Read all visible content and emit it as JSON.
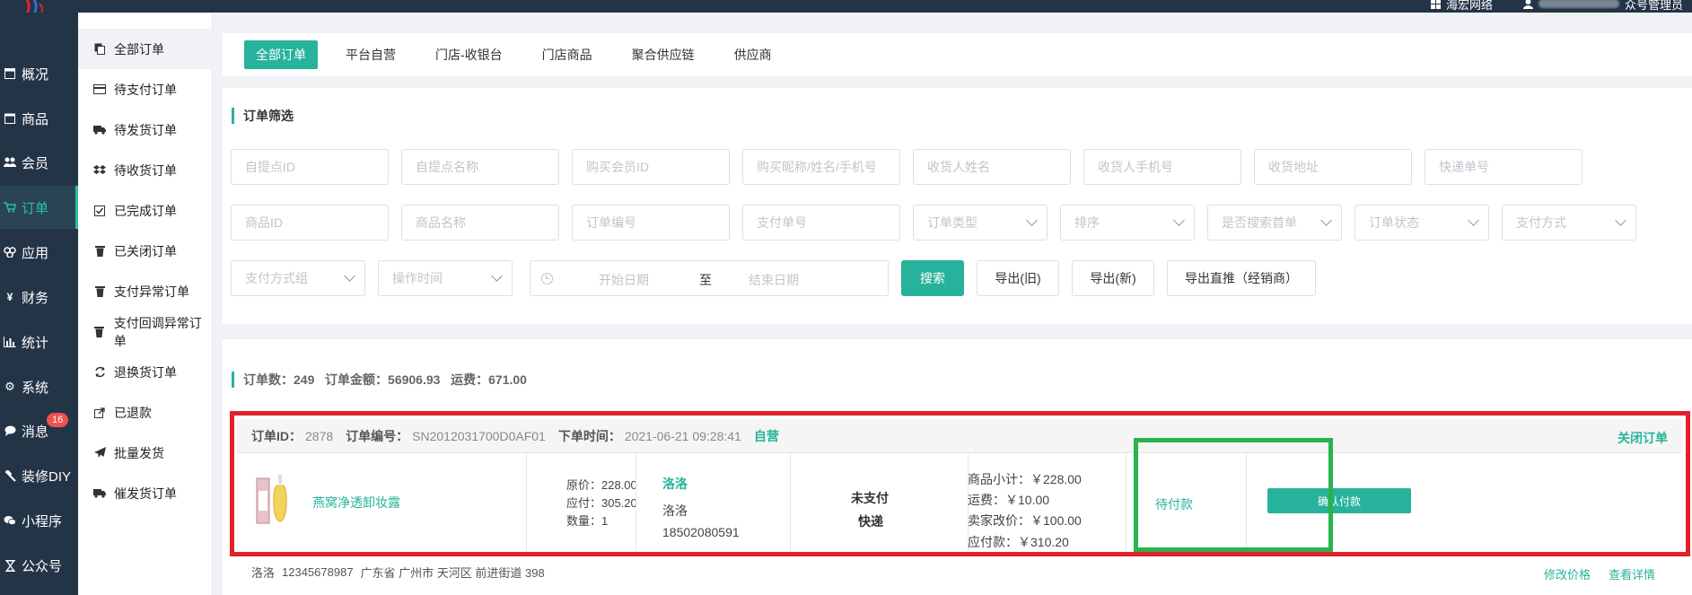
{
  "header": {
    "account_name": "海宏网络",
    "user_suffix": "众号管理员"
  },
  "nav": {
    "items": [
      {
        "label": "概况",
        "icon": "monitor-icon"
      },
      {
        "label": "商品",
        "icon": "box-icon"
      },
      {
        "label": "会员",
        "icon": "users-icon"
      },
      {
        "label": "订单",
        "icon": "cart-icon"
      },
      {
        "label": "应用",
        "icon": "apps-icon"
      },
      {
        "label": "财务",
        "icon": "yen-icon"
      },
      {
        "label": "统计",
        "icon": "bar-chart-icon"
      },
      {
        "label": "系统",
        "icon": "gears-icon"
      },
      {
        "label": "消息",
        "icon": "message-icon"
      },
      {
        "label": "装修DIY",
        "icon": "hammer-icon"
      },
      {
        "label": "小程序",
        "icon": "wechat-icon"
      },
      {
        "label": "公众号",
        "icon": "hourglass-icon"
      }
    ],
    "message_badge": "16"
  },
  "subnav": {
    "items": [
      {
        "label": "全部订单"
      },
      {
        "label": "待支付订单"
      },
      {
        "label": "待发货订单"
      },
      {
        "label": "待收货订单"
      },
      {
        "label": "已完成订单"
      },
      {
        "label": "已关闭订单"
      },
      {
        "label": "支付异常订单"
      },
      {
        "label": "支付回调异常订单"
      },
      {
        "label": "退换货订单"
      },
      {
        "label": "已退款"
      },
      {
        "label": "批量发货"
      },
      {
        "label": "催发货订单"
      }
    ]
  },
  "tabs": [
    {
      "label": "全部订单"
    },
    {
      "label": "平台自营"
    },
    {
      "label": "门店-收银台"
    },
    {
      "label": "门店商品"
    },
    {
      "label": "聚合供应链"
    },
    {
      "label": "供应商"
    }
  ],
  "filter": {
    "title": "订单筛选",
    "row1": [
      "自提点ID",
      "自提点名称",
      "购买会员ID",
      "购买昵称/姓名/手机号",
      "收货人姓名",
      "收货人手机号",
      "收货地址",
      "快递单号"
    ],
    "row2_inputs": [
      "商品ID",
      "商品名称",
      "订单编号",
      "支付单号"
    ],
    "row2_selects": [
      "订单类型",
      "排序",
      "是否搜索首单",
      "订单状态",
      "支付方式"
    ],
    "row3_selects": [
      "支付方式组",
      "操作时间"
    ],
    "date_start": "开始日期",
    "date_sep": "至",
    "date_end": "结束日期",
    "search_label": "搜索",
    "export_old": "导出(旧)",
    "export_new": "导出(新)",
    "export_direct": "导出直推（经销商）"
  },
  "summary": {
    "count_label": "订单数：",
    "count": "249",
    "amount_label": "订单金额：",
    "amount": "56906.93",
    "freight_label": "运费：",
    "freight": "671.00"
  },
  "order": {
    "id_label": "订单ID：",
    "id": "2878",
    "sn_label": "订单编号：",
    "sn": "SN2012031700D0AF01",
    "time_label": "下单时间：",
    "time": "2021-06-21 09:28:41",
    "type": "自营",
    "close_label": "关闭订单",
    "product_name": "燕窝净透卸妆露",
    "price_orig": "原价：228.00",
    "price_pay": "应付：305.20",
    "quantity": "数量：1",
    "buyer_nick": "洛洛",
    "receiver_name": "洛洛",
    "receiver_phone": "18502080591",
    "pay_state": "未支付",
    "delivery": "快递",
    "subtotal": "商品小计：￥228.00",
    "freight": "运费：￥10.00",
    "seller_adjust": "卖家改价：￥100.00",
    "payable": "应付款：￥310.20",
    "status": "待付款",
    "confirm_label": "确认付款",
    "address_name": "洛洛",
    "address_phone": "12345678987",
    "address": "广东省 广州市 天河区 前进街道 398",
    "edit_price": "修改价格",
    "view_detail": "查看详情"
  }
}
